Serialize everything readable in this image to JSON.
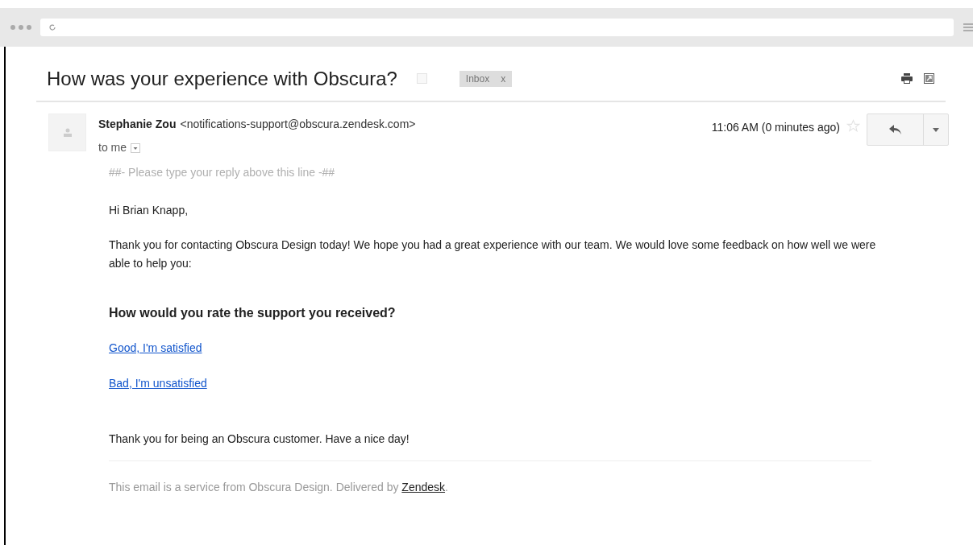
{
  "email": {
    "title": "How was your experience with Obscura?",
    "labels": [
      {
        "name": "Inbox",
        "remove": "x"
      }
    ],
    "sender": {
      "name": "Stephanie Zou",
      "address": "<notifications-support@obscura.zendesk.com>",
      "recipient": "to me"
    },
    "time": "11:06 AM (0 minutes ago)",
    "starred": false,
    "body": {
      "reply_line": "##- Please type your reply above this line -##",
      "greeting": "Hi Brian Knapp,",
      "paragraph": "Thank you for contacting Obscura Design today! We hope you had a great experience with our team. We would love some feedback on how well we were able to help you:",
      "question": "How would you rate the support you received?",
      "links": [
        "Good, I'm satisfied",
        "Bad, I'm unsatisfied"
      ],
      "closing": "Thank you for being an Obscura customer. Have a nice day!",
      "footer": "This email is a service from Obscura Design. Delivered by ",
      "footer_link": "Zendesk",
      "footer_end": "."
    }
  }
}
